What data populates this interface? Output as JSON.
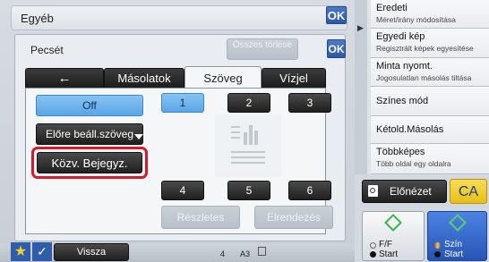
{
  "window": {
    "title": "Egyéb",
    "ok_label": "OK"
  },
  "dialog": {
    "title": "Pecsét",
    "ok_label": "OK",
    "hidden_button_label": "Összes törlése",
    "tabs": [
      {
        "label": "Másolatok"
      },
      {
        "label": "Szöveg"
      },
      {
        "label": "Vízjel"
      }
    ],
    "off_label": "Off",
    "preset_label": "Előre beáll.szöveg",
    "custom_label": "Közv. Bejegyz.",
    "positions": [
      "1",
      "2",
      "3",
      "4",
      "5",
      "6"
    ],
    "details_label": "Részletes",
    "layout_label": "Elrendezés"
  },
  "sidebar": {
    "items": [
      {
        "title": "Eredeti",
        "subtitle": "Méret/irány módosítása"
      },
      {
        "title": "Egyedi kép",
        "subtitle": "Regisztrált képek egyesítése"
      },
      {
        "title": "Minta nyomt.",
        "subtitle": "Jogosulatlan másolás tiltása"
      },
      {
        "title": "Színes mód",
        "subtitle": ""
      },
      {
        "title": "Kétold.Másolás",
        "subtitle": ""
      },
      {
        "title": "Többképes",
        "subtitle": "Több oldal egy oldalra"
      }
    ],
    "preview_label": "Előnézet",
    "ca_label": "CA",
    "bw_start": {
      "line1": "F/F",
      "line2": "Start"
    },
    "color_start": {
      "line1": "Szín",
      "line2": "Start"
    }
  },
  "bottom": {
    "back_label": "Vissza",
    "copies": "4",
    "paper": "A3"
  },
  "colors": {
    "highlight": "#d51a2a",
    "accent_blue": "#2f5da9",
    "ca_yellow": "#f2cf2b",
    "color_start_blue": "#2f63c9"
  }
}
